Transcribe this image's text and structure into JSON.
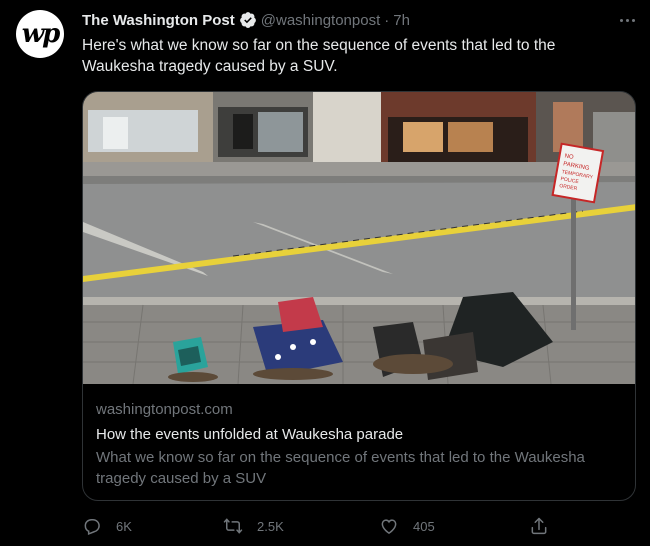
{
  "author": {
    "avatar_text": "wp",
    "name": "The Washington Post",
    "handle": "@washingtonpost",
    "separator": "·",
    "time": "7h"
  },
  "tweet": {
    "text": "Here's what we know so far on the sequence of events that led to the Waukesha tragedy caused by a SUV."
  },
  "card": {
    "domain": "washingtonpost.com",
    "title": "How the events unfolded at Waukesha parade",
    "description": "What we know so far on the sequence of events that led to the Waukesha tragedy caused by a SUV",
    "sign_text": [
      "NO",
      "PARKING",
      "TEMPORARY",
      "POLICE",
      "ORDER"
    ]
  },
  "actions": {
    "replies": "6K",
    "retweets": "2.5K",
    "likes": "405"
  },
  "colors": {
    "background": "#000000",
    "text_primary": "#e7e9ea",
    "text_secondary": "#71767b",
    "verified": "#1d9bf0",
    "border": "#2f3336"
  },
  "icons": [
    "verified-badge-icon",
    "more-options-icon",
    "reply-icon",
    "retweet-icon",
    "like-icon",
    "share-icon"
  ]
}
